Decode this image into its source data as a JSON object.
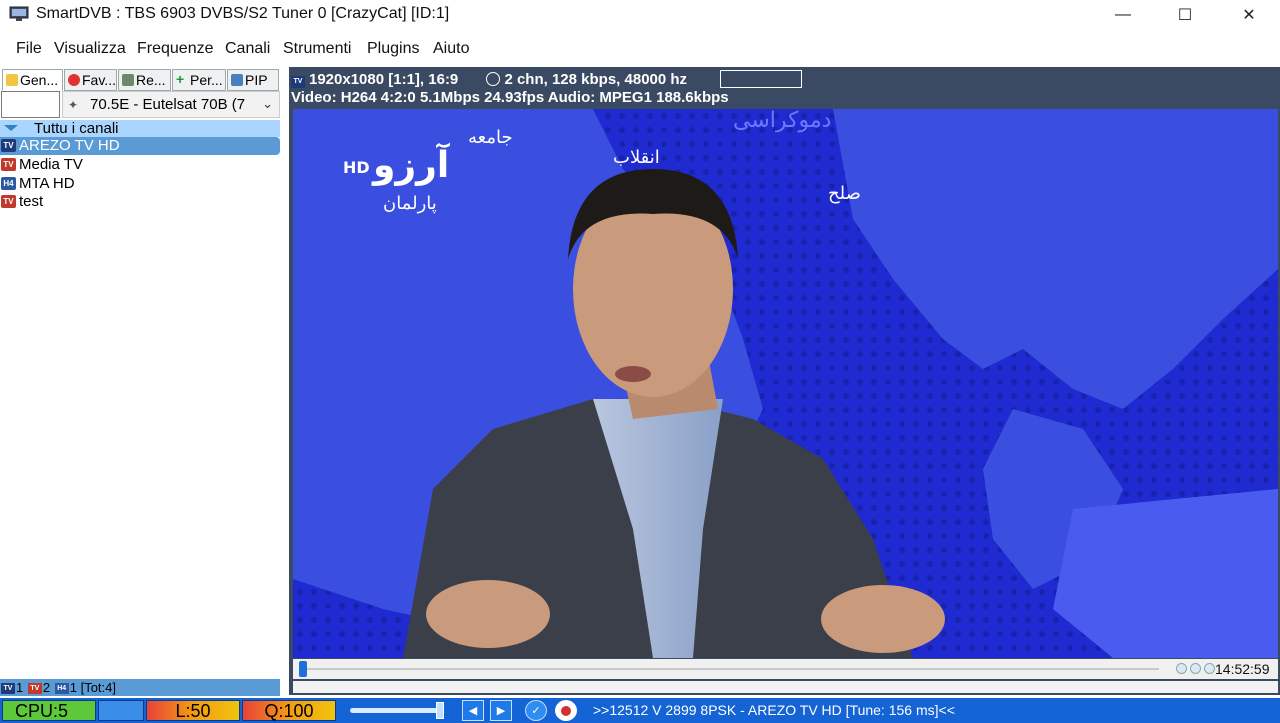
{
  "window": {
    "title": "SmartDVB : TBS 6903 DVBS/S2 Tuner 0 [CrazyCat] [ID:1]",
    "minimize": "—",
    "maximize": "☐",
    "close": "✕"
  },
  "menu": [
    "File",
    "Visualizza",
    "Frequenze",
    "Canali",
    "Strumenti",
    "Plugins",
    "Aiuto"
  ],
  "tabs": [
    {
      "label": "Gen...",
      "icon": "folder-icon"
    },
    {
      "label": "Fav...",
      "icon": "favorites-icon"
    },
    {
      "label": "Re...",
      "icon": "record-icon"
    },
    {
      "label": "Per...",
      "icon": "plus-icon"
    },
    {
      "label": "PIP",
      "icon": "pip-icon"
    }
  ],
  "satellite": {
    "selected": "70.5E - Eutelsat 70B (7"
  },
  "channel_group": "Tuttu i canali",
  "channels": [
    {
      "badge": "TV",
      "name": "AREZO TV HD",
      "selected": true
    },
    {
      "badge": "TV",
      "name": "Media TV",
      "selected": false
    },
    {
      "badge": "H4",
      "name": "MTA HD",
      "selected": false
    },
    {
      "badge": "TV",
      "name": "test",
      "selected": false
    }
  ],
  "left_status": {
    "tv_count": "1",
    "r_count": "2",
    "h4_count": "1",
    "total": "[Tot:4]"
  },
  "video_info": {
    "line1_res": "1920x1080 [1:1], 16:9",
    "line1_audio": "2 chn, 128 kbps, 48000 hz",
    "line2": "Video: H264 4:2:0 5.1Mbps 24.93fps   Audio: MPEG1 188.6kbps"
  },
  "video": {
    "logo_latin": "HD",
    "logo_text": "آرزو",
    "map_labels": [
      "جامعه",
      "انقلاب",
      "دموکراسی",
      "صلح",
      "پارلمان"
    ]
  },
  "playback": {
    "time": "14:52:59",
    "position": 0.0
  },
  "statusbar": {
    "cpu": "CPU:5",
    "level": "L:50",
    "quality": "Q:100",
    "message": ">>12512 V 2899 8PSK - AREZO TV HD [Tune: 156 ms]<<",
    "volume": 0.92
  },
  "colors": {
    "accent": "#5b9bd5",
    "status_bar": "#1464d6",
    "video_bg": "#1f2bd0"
  }
}
